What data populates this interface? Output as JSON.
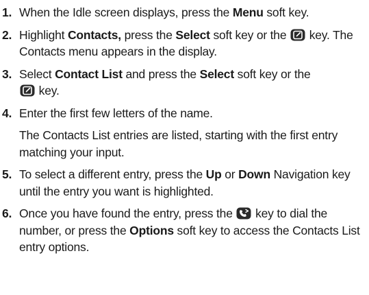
{
  "steps": [
    {
      "number": "1.",
      "parts": [
        "When the Idle screen displays, press the ",
        "Menu",
        " soft key."
      ]
    },
    {
      "number": "2.",
      "parts": [
        "Highlight ",
        "Contacts,",
        " press the ",
        "Select",
        " soft key or the ",
        " key. The Contacts menu appears in the display."
      ]
    },
    {
      "number": "3.",
      "parts": [
        "Select ",
        "Contact List",
        " and press the ",
        "Select",
        " soft key or the",
        " key."
      ]
    },
    {
      "number": "4.",
      "parts": [
        "Enter the first few letters of the name."
      ],
      "sub_text": "The Contacts List entries are listed, starting with the first entry matching your input."
    },
    {
      "number": "5.",
      "parts": [
        "To select a different entry, press the ",
        "Up",
        " or ",
        "Down",
        " Navigation key until the entry you want is highlighted."
      ]
    },
    {
      "number": "6.",
      "parts": [
        "Once you have found the entry, press the ",
        " key to dial the number, or press the ",
        "Options",
        " soft key to access the Contacts List entry options."
      ]
    }
  ],
  "icons": {
    "ok_key": "ok-key-icon",
    "send_key": "send-key-icon"
  }
}
